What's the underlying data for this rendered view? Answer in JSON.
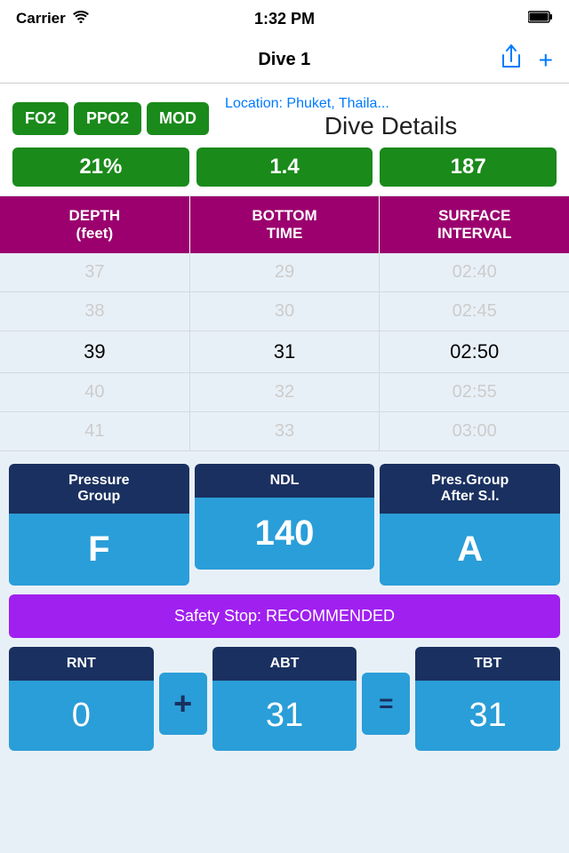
{
  "status": {
    "carrier": "Carrier",
    "wifi": "📶",
    "time": "1:32 PM",
    "battery": "🔋"
  },
  "nav": {
    "title": "Dive 1",
    "share_label": "Share",
    "add_label": "Add"
  },
  "gas": {
    "labels": [
      "FO2",
      "PPO2",
      "MOD"
    ],
    "values": [
      "21%",
      "1.4",
      "187"
    ],
    "location": "Location: Phuket, Thaila...",
    "details_title": "Dive Details"
  },
  "picker": {
    "col1_header": "DEPTH\n(feet)",
    "col2_header": "BOTTOM\nTIME",
    "col3_header": "SURFACE\nINTERVAL",
    "col1_values": [
      "38",
      "39",
      "40"
    ],
    "col2_values": [
      "30",
      "31",
      "32"
    ],
    "col3_values": [
      "02:45",
      "02:50",
      "02:55"
    ],
    "selected_index": 1
  },
  "ndl": {
    "pressure_group_label": "Pressure\nGroup",
    "ndl_label": "NDL",
    "pres_after_label": "Pres.Group\nAfter S.I.",
    "pressure_group_value": "F",
    "ndl_value": "140",
    "pres_after_value": "A"
  },
  "safety_stop": {
    "text": "Safety Stop: RECOMMENDED"
  },
  "rnt": {
    "rnt_label": "RNT",
    "plus_symbol": "+",
    "abt_label": "ABT",
    "equals_symbol": "=",
    "tbt_label": "TBT",
    "rnt_value": "0",
    "abt_value": "31",
    "tbt_value": "31"
  }
}
